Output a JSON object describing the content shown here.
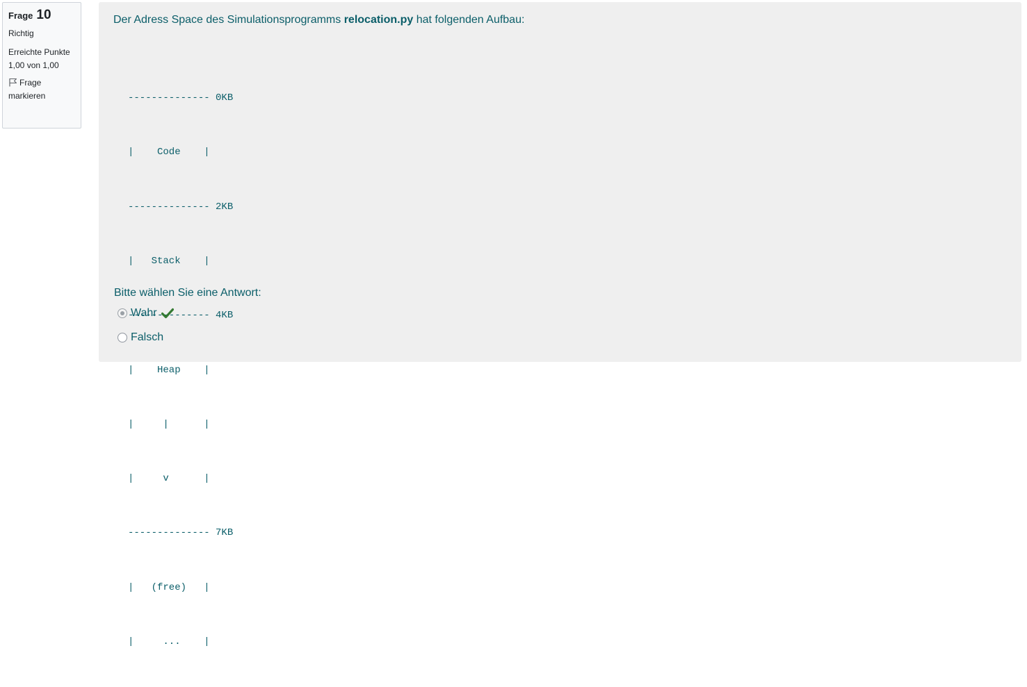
{
  "info": {
    "question_label": "Frage",
    "question_number": "10",
    "state": "Richtig",
    "grade": "Erreichte Punkte 1,00 von 1,00",
    "flag_label": "Frage markieren"
  },
  "question": {
    "text_before": "Der Adress Space des Simulationsprogramms ",
    "text_bold": "relocation.py",
    "text_after": " hat folgenden Aufbau:",
    "address_space_lines": [
      "-------------- 0KB",
      "|    Code    |",
      "-------------- 2KB",
      "|   Stack    |",
      "-------------- 4KB",
      "|    Heap    |",
      "|     |      |",
      "|     v      |",
      "-------------- 7KB",
      "|   (free)   |",
      "|     ...    |"
    ],
    "prompt": "Bitte wählen Sie eine Antwort:",
    "answers": [
      {
        "label": "Wahr",
        "selected": true,
        "correct": true
      },
      {
        "label": "Falsch",
        "selected": false,
        "correct": false
      }
    ]
  },
  "icons": {
    "flag": "flag-icon",
    "correct": "checkmark-icon"
  },
  "colors": {
    "text": "#0b5e69",
    "correct": "#357a32",
    "panel_bg": "#efefef",
    "info_bg": "#f8f9fa"
  }
}
